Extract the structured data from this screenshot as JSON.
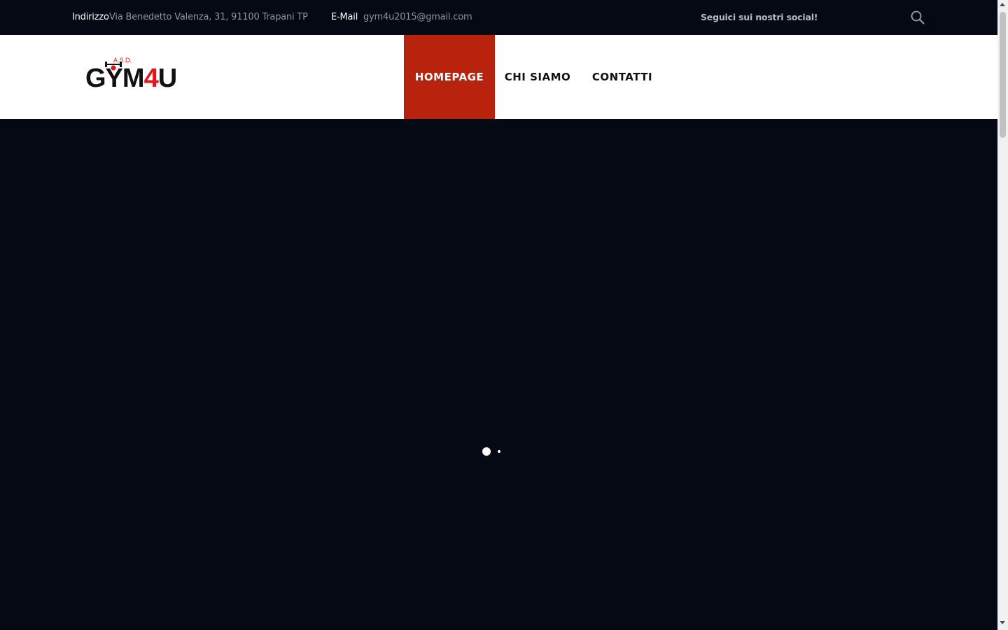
{
  "topbar": {
    "address_label": "Indirizzo",
    "address_value": "Via Benedetto Valenza, 31, 91100 Trapani TP",
    "email_label": "E-Mail",
    "email_value": "gym4u2015@gmail.com",
    "social_text": "Seguici sui nostri social!",
    "search_icon": "search-icon"
  },
  "logo": {
    "top_text": "A.S.D.",
    "text_left": "GYM",
    "text_accent": "4",
    "text_right": "U",
    "accent_color": "#e0181b"
  },
  "nav": {
    "items": [
      {
        "label": "HOMEPAGE",
        "active": true
      },
      {
        "label": "CHI SIAMO",
        "active": false
      },
      {
        "label": "CONTATTI",
        "active": false
      }
    ],
    "active_color": "#b8230d"
  },
  "hero": {
    "background": "#050913",
    "slider_dots": [
      {
        "active": true
      },
      {
        "active": false
      }
    ]
  }
}
